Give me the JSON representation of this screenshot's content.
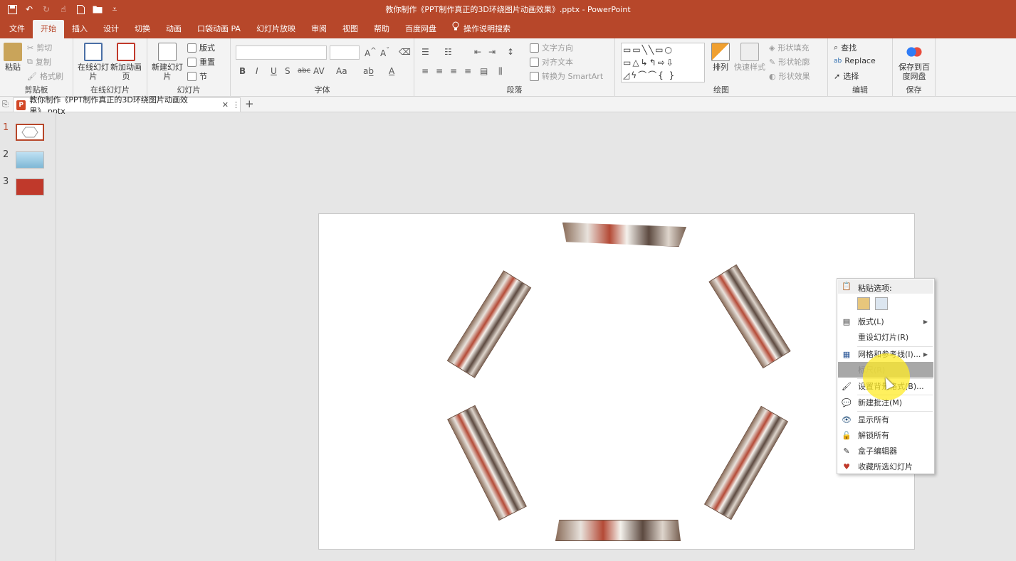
{
  "app": {
    "title": "教你制作《PPT制作真正的3D环绕图片动画效果》.pptx  -  PowerPoint",
    "brand_color": "#b7472a",
    "quick_access": [
      "save-icon",
      "undo-icon",
      "redo-icon",
      "touch-mode-icon",
      "new-file-icon",
      "open-folder-icon",
      "customize-icon"
    ]
  },
  "menu_tabs": [
    {
      "label": "文件"
    },
    {
      "label": "开始",
      "active": true
    },
    {
      "label": "插入"
    },
    {
      "label": "设计"
    },
    {
      "label": "切换"
    },
    {
      "label": "动画"
    },
    {
      "label": "口袋动画 PA"
    },
    {
      "label": "幻灯片放映"
    },
    {
      "label": "审阅"
    },
    {
      "label": "视图"
    },
    {
      "label": "帮助"
    },
    {
      "label": "百度网盘"
    },
    {
      "label": "操作说明搜索"
    }
  ],
  "ribbon": {
    "clipboard": {
      "paste": "粘贴",
      "cut": "剪切",
      "copy": "复制",
      "format_painter": "格式刷",
      "label": "剪贴板"
    },
    "online_slides": {
      "online": "在线幻灯片",
      "new_anim": "新加动画页",
      "label": "在线幻灯片"
    },
    "slides": {
      "new_slide": "新建幻灯片",
      "layout": "版式",
      "reset": "重置",
      "section": "节",
      "label": "幻灯片"
    },
    "font": {
      "label": "字体",
      "bold": "B",
      "italic": "I",
      "underline": "U",
      "shadow": "S",
      "strike": "abc",
      "spacing": "AV",
      "case": "Aa",
      "color": "A"
    },
    "paragraph": {
      "text_direction": "文字方向",
      "align_text": "对齐文本",
      "smartart": "转换为 SmartArt",
      "label": "段落"
    },
    "drawing": {
      "arrange": "排列",
      "quick_styles": "快速样式",
      "fill": "形状填充",
      "outline": "形状轮廓",
      "effects": "形状效果",
      "label": "绘图"
    },
    "editing": {
      "find": "查找",
      "replace": "Replace",
      "select": "选择",
      "label": "编辑"
    },
    "save": {
      "save_to": "保存到百度网盘",
      "label": "保存"
    }
  },
  "document_tab": {
    "title": "教你制作《PPT制作真正的3D环绕图片动画效果》.pptx"
  },
  "thumbnails": [
    {
      "number": "1",
      "selected": true
    },
    {
      "number": "2"
    },
    {
      "number": "3"
    }
  ],
  "context_menu": {
    "paste_header": "粘贴选项:",
    "items": [
      {
        "label": "版式(L)",
        "icon": "layout-icon",
        "submenu": true
      },
      {
        "label": "重设幻灯片(R)",
        "icon": ""
      },
      {
        "label": "网格和参考线(I)...",
        "icon": "grid-icon",
        "submenu": true
      },
      {
        "label": "标尺(R)",
        "icon": "",
        "highlighted": true
      },
      {
        "label": "设置背景格式(B)...",
        "icon": "background-format-icon"
      },
      {
        "label": "新建批注(M)",
        "icon": "new-comment-icon"
      },
      {
        "label": "显示所有",
        "icon": "eye-icon"
      },
      {
        "label": "解锁所有",
        "icon": "unlock-icon"
      },
      {
        "label": "盒子编辑器",
        "icon": "edit-icon"
      },
      {
        "label": "收藏所选幻灯片",
        "icon": "favorite-heart-icon"
      }
    ]
  }
}
